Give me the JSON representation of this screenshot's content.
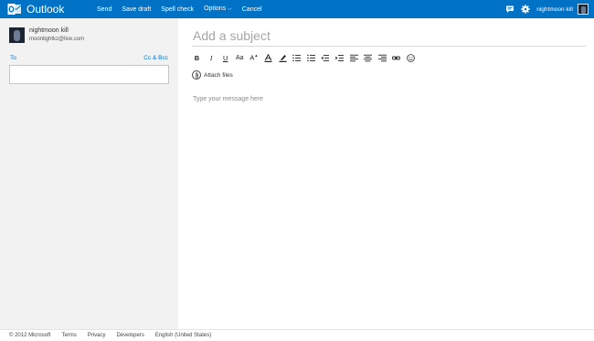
{
  "header": {
    "brand": "Outlook",
    "commands": [
      "Send",
      "Save draft",
      "Spell check",
      "Options",
      "Cancel"
    ],
    "user_name": "nightmoon kill",
    "icons": [
      "outlook-logo-icon",
      "chat-icon",
      "gear-icon",
      "avatar"
    ],
    "accent_color": "#0072c6"
  },
  "from": {
    "name": "nightmoon kill",
    "email": "moonlightkz@live.com"
  },
  "recipients": {
    "to_label": "To",
    "cc_bcc_label": "Cc & Bcc",
    "to_value": ""
  },
  "compose": {
    "subject_placeholder": "Add a subject",
    "subject_value": "",
    "attach_label": "Attach files",
    "message_placeholder": "Type your message here",
    "toolbar": {
      "bold": "B",
      "italic": "I",
      "underline": "U",
      "font_size": "Aa",
      "grow_font": "A",
      "font_color": "A"
    },
    "toolbar_icons": [
      "bold",
      "italic",
      "underline",
      "font-size",
      "grow-font",
      "font-color",
      "highlight",
      "numbered-list",
      "bulleted-list",
      "outdent",
      "indent",
      "align-left",
      "align-center",
      "align-right",
      "link",
      "emoticon"
    ]
  },
  "footer": {
    "copyright": "© 2012 Microsoft",
    "links": [
      "Terms",
      "Privacy",
      "Developers",
      "English (United States)"
    ]
  }
}
